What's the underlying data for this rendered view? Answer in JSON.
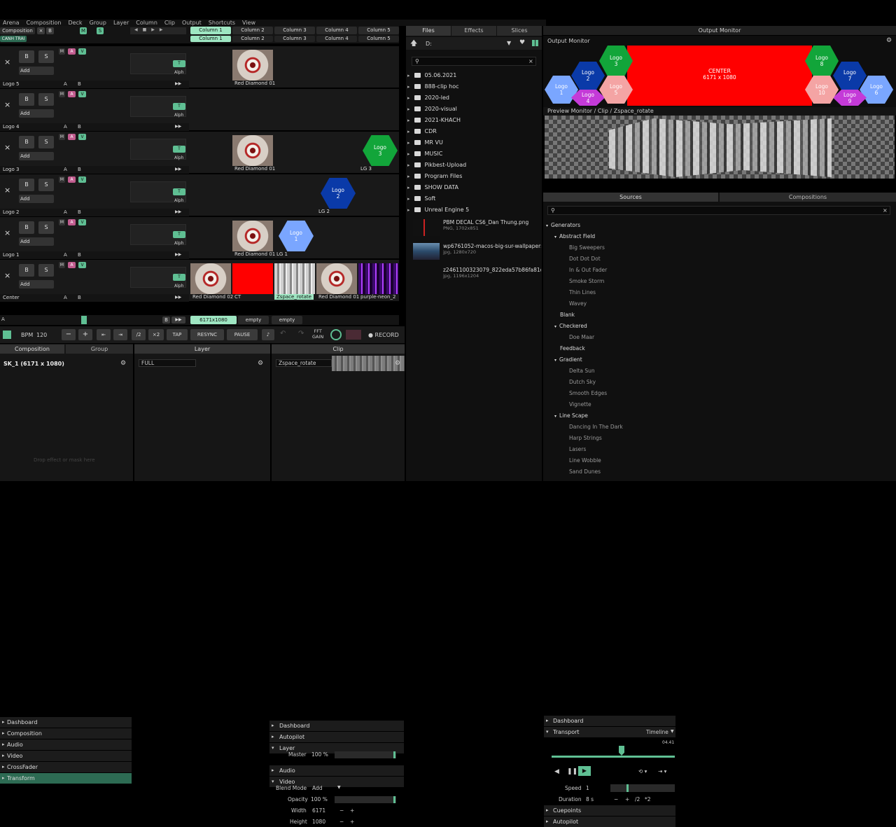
{
  "menu": [
    "Arena",
    "Composition",
    "Deck",
    "Group",
    "Layer",
    "Column",
    "Clip",
    "Output",
    "Shortcuts",
    "View"
  ],
  "composition_label": "Composition",
  "canh_trai": "CANH TRAI",
  "columns": [
    "Column 1",
    "Column 2",
    "Column 3",
    "Column 4",
    "Column 5"
  ],
  "layer_btn": {
    "x": "×",
    "b": "B",
    "s": "S",
    "add": "Add",
    "m": "M",
    "a": "A",
    "v": "V",
    "ab_a": "A",
    "ab_b": "B",
    "t": "T",
    "alph": "Alph"
  },
  "layers": [
    {
      "name": "Logo 5",
      "clips": [
        {
          "col": 1,
          "name": "Red Diamond 01",
          "kind": "diamond"
        }
      ]
    },
    {
      "name": "Logo 4",
      "clips": []
    },
    {
      "name": "Logo 3",
      "clips": [
        {
          "col": 1,
          "name": "Red Diamond 01",
          "kind": "diamond"
        },
        {
          "col": 4,
          "name": "LG 3",
          "kind": "hexgreen",
          "label": "Logo\n3"
        }
      ]
    },
    {
      "name": "Logo 2",
      "clips": [
        {
          "col": 3,
          "name": "LG 2",
          "kind": "hexblue",
          "label": "Logo\n2"
        }
      ]
    },
    {
      "name": "Logo 1",
      "clips": [
        {
          "col": 1,
          "name": "Red Diamond 01",
          "kind": "diamond"
        },
        {
          "col": 2,
          "name": "LG 1",
          "kind": "hexlight",
          "label": "Logo\n1"
        }
      ]
    },
    {
      "name": "Center",
      "clips": [
        {
          "col": 0,
          "name": "Red Diamond 02",
          "kind": "diamond"
        },
        {
          "col": 1,
          "name": "CT",
          "kind": "red"
        },
        {
          "col": 2,
          "name": "Zspace_rotate",
          "kind": "zspace"
        },
        {
          "col": 3,
          "name": "Red Diamond 01",
          "kind": "diamond"
        },
        {
          "col": 4,
          "name": "purple-neon_2",
          "kind": "purple"
        }
      ]
    }
  ],
  "deck": {
    "a": "A",
    "b": "B",
    "res": "6171x1080",
    "empty1": "empty",
    "empty2": "empty"
  },
  "transport": {
    "bpm_label": "BPM",
    "bpm": "120",
    "minus": "−",
    "plus": "+",
    "half": "/2",
    "double": "×2",
    "tap": "TAP",
    "resync": "RESYNC",
    "pause": "PAUSE",
    "fft": "FFT\nGAIN",
    "record": "RECORD"
  },
  "bottom_tabs": {
    "composition": "Composition",
    "group": "Group",
    "layer": "Layer",
    "clip": "Clip"
  },
  "comp_panel": {
    "title": "SK_1 (6171 x 1080)",
    "items": [
      "Dashboard",
      "Composition",
      "Audio",
      "Video",
      "CrossFader",
      "Transform"
    ],
    "drop": "Drop effect or mask here"
  },
  "layer_panel": {
    "name": "FULL",
    "items": [
      "Dashboard",
      "Autopilot",
      "Layer",
      "Audio",
      "Video"
    ],
    "master_label": "Master",
    "master_val": "100 %",
    "blend_label": "Blend Mode",
    "blend_val": "Add",
    "opacity_label": "Opacity",
    "opacity_val": "100 %",
    "width_label": "Width",
    "width_val": "6171",
    "height_label": "Height",
    "height_val": "1080"
  },
  "clip_panel": {
    "name": "Zspace_rotate",
    "items": [
      "Dashboard",
      "Transport",
      "Cuepoints",
      "Autopilot"
    ],
    "timeline": "Timeline",
    "time": "04.41",
    "speed_label": "Speed",
    "speed_val": "1",
    "duration_label": "Duration",
    "duration_val": "8 s",
    "half": "/2",
    "double": "*2"
  },
  "files_tabs": [
    "Files",
    "Effects",
    "Slices"
  ],
  "drive": "D:",
  "folders": [
    "05.06.2021",
    "888-clip hoc",
    "2020-led",
    "2020-visual",
    "2021-KHACH",
    "CDR",
    "MR VU",
    "MUSIC",
    "Pikbest-Upload",
    "Program Files",
    "SHOW DATA",
    "Soft",
    "Unreal Engine 5"
  ],
  "files": [
    {
      "name": "PBM DECAL CS6_Dan Thung.png",
      "info": "PNG, 1702x851"
    },
    {
      "name": "wp6761052-macos-big-sur-wallpapers.jpg",
      "info": "jpg, 1280x720"
    },
    {
      "name": "z2461100323079_822eda57b86fa81d640f7025783438...",
      "info": "jpg, 1196x1204"
    }
  ],
  "output_monitor": {
    "title": "Output Monitor",
    "label": "Output Monitor",
    "center": "CENTER",
    "center_res": "6171 x 1080",
    "logos": [
      "Logo\n1",
      "Logo\n2",
      "Logo\n3",
      "Logo\n4",
      "Logo\n5",
      "Logo\n6",
      "Logo\n7",
      "Logo\n8",
      "Logo\n9",
      "Logo\n10"
    ]
  },
  "preview_label": "Preview Monitor / Clip / Zspace_rotate",
  "sources_tabs": [
    "Sources",
    "Compositions"
  ],
  "tree": [
    {
      "t": "Generators",
      "lvl": 0,
      "exp": true
    },
    {
      "t": "Abstract Field",
      "lvl": 1,
      "exp": true
    },
    {
      "t": "Big Sweepers",
      "lvl": 2
    },
    {
      "t": "Dot Dot Dot",
      "lvl": 2
    },
    {
      "t": "In & Out Fader",
      "lvl": 2
    },
    {
      "t": "Smoke Storm",
      "lvl": 2
    },
    {
      "t": "Thin Lines",
      "lvl": 2
    },
    {
      "t": "Wavey",
      "lvl": 2
    },
    {
      "t": "Blank",
      "lvl": 1
    },
    {
      "t": "Checkered",
      "lvl": 1,
      "exp": true
    },
    {
      "t": "Doe Maar",
      "lvl": 2
    },
    {
      "t": "Feedback",
      "lvl": 1
    },
    {
      "t": "Gradient",
      "lvl": 1,
      "exp": true
    },
    {
      "t": "Delta Sun",
      "lvl": 2
    },
    {
      "t": "Dutch Sky",
      "lvl": 2
    },
    {
      "t": "Smooth Edges",
      "lvl": 2
    },
    {
      "t": "Vignette",
      "lvl": 2
    },
    {
      "t": "Line Scape",
      "lvl": 1,
      "exp": true
    },
    {
      "t": "Dancing In The Dark",
      "lvl": 2
    },
    {
      "t": "Harp Strings",
      "lvl": 2
    },
    {
      "t": "Lasers",
      "lvl": 2
    },
    {
      "t": "Line Wobble",
      "lvl": 2
    },
    {
      "t": "Sand Dunes",
      "lvl": 2
    }
  ],
  "colors": {
    "accent": "#5fbf93",
    "red": "#ff0000",
    "logo_blue": "#0a3aa8",
    "logo_green": "#12a53a",
    "logo_light": "#7aa6ff",
    "logo_pink": "#f4a4a4",
    "logo_magenta": "#c43ad8"
  }
}
